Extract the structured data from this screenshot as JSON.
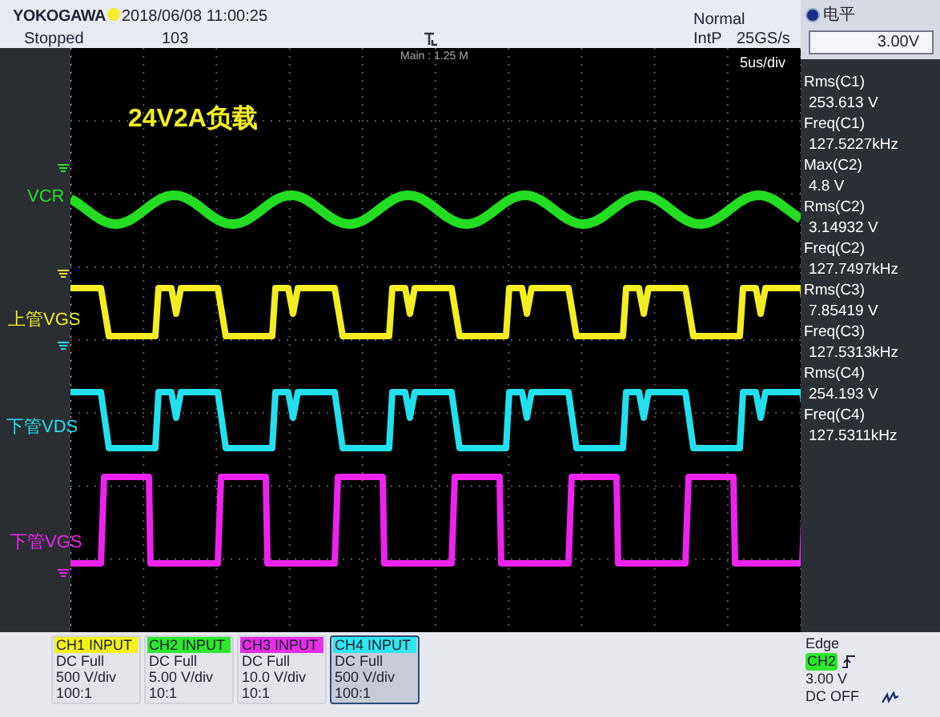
{
  "header": {
    "brand": "YOKOGAWA",
    "status": "Stopped",
    "datetime": "2018/06/08 11:00:25",
    "count": "103",
    "mode": "Normal",
    "sampling": "IntP",
    "rate": "25GS/s"
  },
  "level_control": {
    "label": "电平",
    "value": "3.00V"
  },
  "display": {
    "record_length": "Main : 1.25 M",
    "timebase": "5us/div",
    "annotation": "24V2A负载",
    "traces": [
      {
        "label": "VCR",
        "color": "#22dd22",
        "kind": "sine"
      },
      {
        "label": "上管VGS",
        "color": "#f2ee22",
        "kind": "square"
      },
      {
        "label": "下管VDS",
        "color": "#22e0ee",
        "kind": "square"
      },
      {
        "label": "下管VGS",
        "color": "#ee22ee",
        "kind": "pulse"
      }
    ]
  },
  "measurements": [
    {
      "name": "Rms(C1)",
      "value": "253.613 V"
    },
    {
      "name": "Freq(C1)",
      "value": "127.5227kHz"
    },
    {
      "name": "Max(C2)",
      "value": "4.8 V"
    },
    {
      "name": "Rms(C2)",
      "value": "3.14932 V"
    },
    {
      "name": "Freq(C2)",
      "value": "127.7497kHz"
    },
    {
      "name": "Rms(C3)",
      "value": "7.85419 V"
    },
    {
      "name": "Freq(C3)",
      "value": "127.5313kHz"
    },
    {
      "name": "Rms(C4)",
      "value": "254.193 V"
    },
    {
      "name": "Freq(C4)",
      "value": "127.5311kHz"
    }
  ],
  "channels": [
    {
      "title": "CH1 INPUT",
      "color": "#f4f01c",
      "coupling": "DC Full",
      "scale": "500 V/div",
      "probe": "100:1",
      "selected": false
    },
    {
      "title": "CH2 INPUT",
      "color": "#2ee82e",
      "coupling": "DC Full",
      "scale": "5.00 V/div",
      "probe": "10:1",
      "selected": false
    },
    {
      "title": "CH3 INPUT",
      "color": "#e62ee6",
      "coupling": "DC Full",
      "scale": "10.0 V/div",
      "probe": "10:1",
      "selected": false
    },
    {
      "title": "CH4 INPUT",
      "color": "#2ee6f0",
      "coupling": "DC Full",
      "scale": "500 V/div",
      "probe": "100:1",
      "selected": true
    }
  ],
  "trigger": {
    "type": "Edge",
    "source": "CH2",
    "level": "3.00 V",
    "filter": "DC OFF"
  }
}
